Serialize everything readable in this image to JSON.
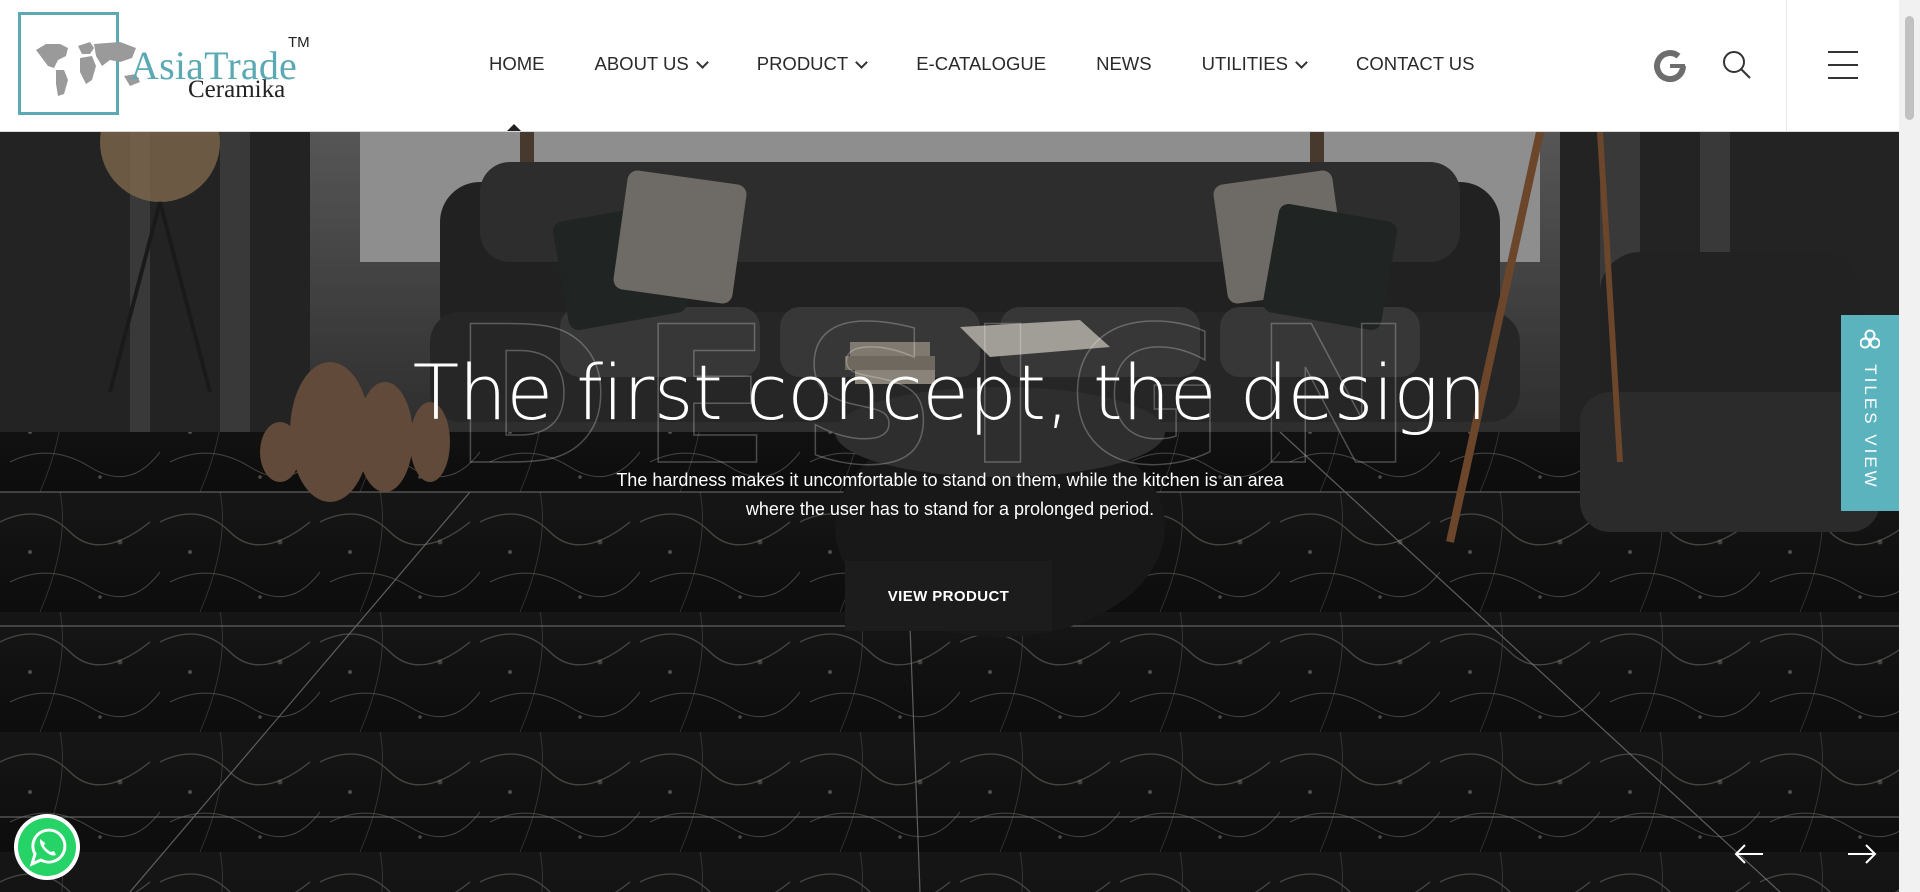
{
  "brand": {
    "name_top": "AsiaTrade",
    "name_bottom": "Ceramika",
    "trademark": "TM"
  },
  "nav": {
    "items": [
      {
        "label": "HOME",
        "dropdown": false,
        "active": true
      },
      {
        "label": "ABOUT US",
        "dropdown": true
      },
      {
        "label": "PRODUCT",
        "dropdown": true
      },
      {
        "label": "E-CATALOGUE",
        "dropdown": false
      },
      {
        "label": "NEWS",
        "dropdown": false
      },
      {
        "label": "UTILITIES",
        "dropdown": true
      },
      {
        "label": "CONTACT US",
        "dropdown": false
      }
    ]
  },
  "header_icons": [
    "google-icon",
    "search-icon",
    "menu-icon"
  ],
  "hero": {
    "watermark": "DESIGN",
    "title": "The first concept, the design",
    "subtitle_line1": "The hardness makes it uncomfortable to stand on them, while the kitchen is an area",
    "subtitle_line2": "where the user has to stand for a prolonged period.",
    "button_label": "VIEW PRODUCT"
  },
  "side_tab": {
    "label": "TILES VIEW"
  },
  "colors": {
    "accent": "#5ab3bd",
    "logo": "#5aa9b3",
    "button_bg": "#1c1c1c",
    "whatsapp": "#25d366"
  }
}
